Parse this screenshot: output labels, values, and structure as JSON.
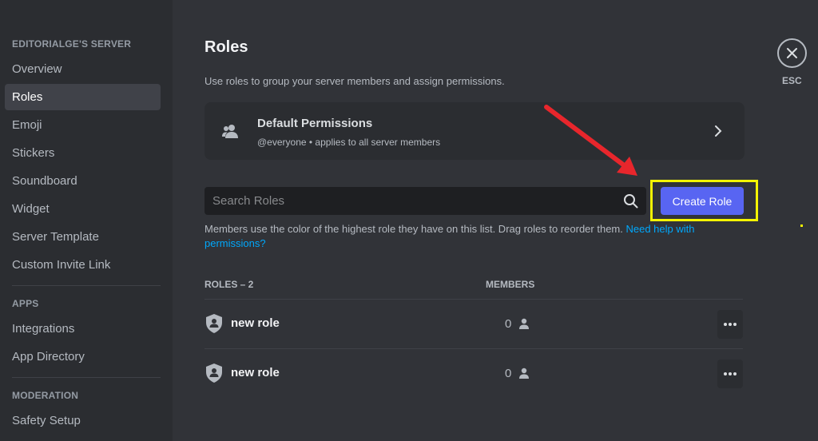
{
  "sidebar": {
    "server_header": "EDITORIALGE'S SERVER",
    "server_items": [
      {
        "label": "Overview",
        "active": false
      },
      {
        "label": "Roles",
        "active": true
      },
      {
        "label": "Emoji",
        "active": false
      },
      {
        "label": "Stickers",
        "active": false
      },
      {
        "label": "Soundboard",
        "active": false
      },
      {
        "label": "Widget",
        "active": false
      },
      {
        "label": "Server Template",
        "active": false
      },
      {
        "label": "Custom Invite Link",
        "active": false
      }
    ],
    "apps_header": "APPS",
    "apps_items": [
      {
        "label": "Integrations"
      },
      {
        "label": "App Directory"
      }
    ],
    "moderation_header": "MODERATION",
    "moderation_items": [
      {
        "label": "Safety Setup"
      }
    ]
  },
  "main": {
    "title": "Roles",
    "description": "Use roles to group your server members and assign permissions.",
    "default_permissions": {
      "title": "Default Permissions",
      "subtitle": "@everyone • applies to all server members"
    },
    "search": {
      "placeholder": "Search Roles",
      "value": ""
    },
    "create_role_label": "Create Role",
    "help_text": "Members use the color of the highest role they have on this list. Drag roles to reorder them. ",
    "help_link": "Need help with permissions?",
    "columns": {
      "roles": "ROLES – 2",
      "members": "MEMBERS"
    },
    "roles": [
      {
        "name": "new role",
        "members": "0"
      },
      {
        "name": "new role",
        "members": "0"
      }
    ]
  },
  "close": {
    "label": "ESC"
  },
  "colors": {
    "accent": "#5865f2",
    "highlight": "#f4f403",
    "annotation_arrow": "#e8262c",
    "link": "#00a8fc"
  }
}
